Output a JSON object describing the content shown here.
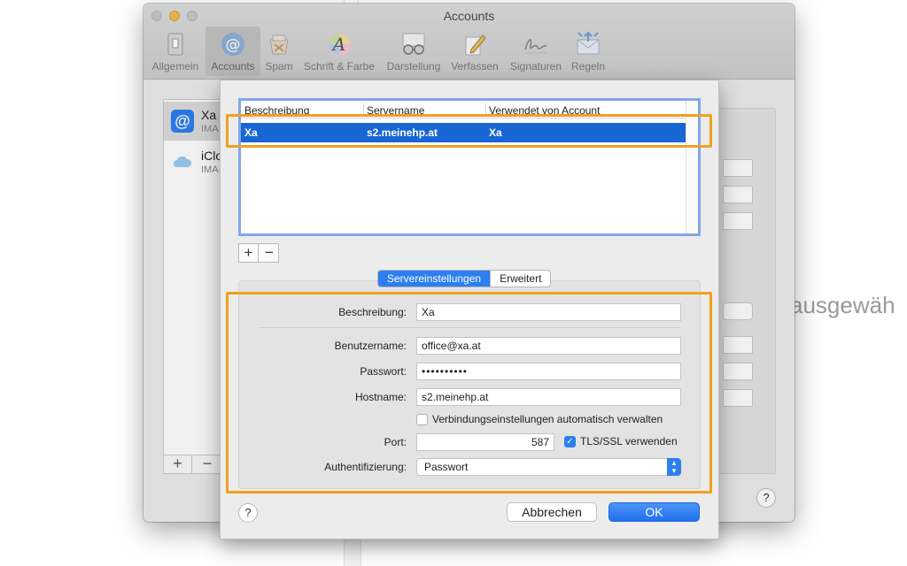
{
  "window": {
    "title": "Accounts"
  },
  "toolbar": {
    "items": [
      {
        "label": "Allgemein",
        "icon": "switch-icon"
      },
      {
        "label": "Accounts",
        "icon": "at-icon"
      },
      {
        "label": "Spam",
        "icon": "junk-mail-icon"
      },
      {
        "label": "Schrift & Farbe",
        "icon": "font-color-icon"
      },
      {
        "label": "Darstellung",
        "icon": "glasses-icon"
      },
      {
        "label": "Verfassen",
        "icon": "pencil-icon"
      },
      {
        "label": "Signaturen",
        "icon": "signature-icon"
      },
      {
        "label": "Regeln",
        "icon": "rules-icon"
      }
    ],
    "active_index": 1
  },
  "accounts": [
    {
      "name": "Xa",
      "type": "IMA",
      "icon": "at-icon"
    },
    {
      "name": "iClo",
      "type": "IMA",
      "icon": "cloud-icon"
    }
  ],
  "background_text": "ausgewäh",
  "server_table": {
    "headers": [
      "Beschreibung",
      "Servername",
      "Verwendet von Account"
    ],
    "rows": [
      {
        "beschreibung": "Xa",
        "servername": "s2.meinehp.at",
        "verwendet": "Xa"
      }
    ]
  },
  "segments": {
    "server": "Servereinstellungen",
    "advanced": "Erweitert"
  },
  "form": {
    "beschreibung_label": "Beschreibung:",
    "beschreibung_value": "Xa",
    "benutzername_label": "Benutzername:",
    "benutzername_value": "office@xa.at",
    "passwort_label": "Passwort:",
    "passwort_value": "••••••••••",
    "hostname_label": "Hostname:",
    "hostname_value": "s2.meinehp.at",
    "auto_manage_label": "Verbindungseinstellungen automatisch verwalten",
    "auto_manage_checked": false,
    "port_label": "Port:",
    "port_value": "587",
    "tls_label": "TLS/SSL verwenden",
    "tls_checked": true,
    "auth_label": "Authentifizierung:",
    "auth_value": "Passwort"
  },
  "buttons": {
    "plus": "+",
    "minus": "−",
    "help": "?",
    "cancel": "Abbrechen",
    "ok": "OK"
  },
  "colors": {
    "accent": "#2d7ff0",
    "selection": "#1866d4",
    "highlight": "#f0a020"
  }
}
